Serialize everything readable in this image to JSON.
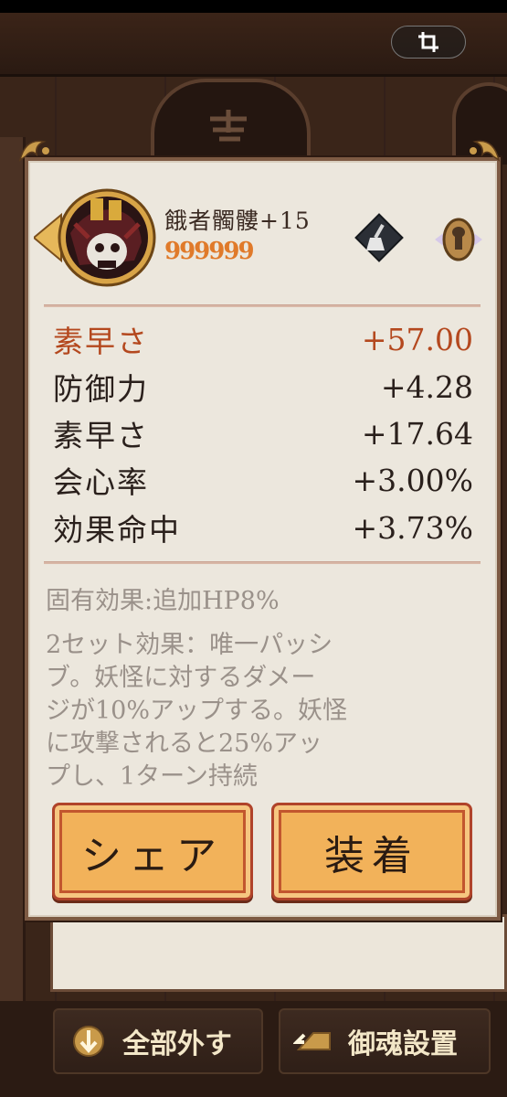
{
  "crop_icon": "crop-icon",
  "item": {
    "name": "餓者髑髏+15",
    "stars": "999999",
    "avatar_icon": "skull-armor-icon",
    "brush_icon": "brush-icon",
    "lock_icon": "lock-icon"
  },
  "stats": {
    "main": {
      "label": "素早さ",
      "value": "+57.00"
    },
    "subs": [
      {
        "label": "防御力",
        "value": "+4.28"
      },
      {
        "label": "素早さ",
        "value": "+17.64"
      },
      {
        "label": "会心率",
        "value": "+3.00%"
      },
      {
        "label": "効果命中",
        "value": "+3.73%"
      }
    ]
  },
  "effects": {
    "inherent": "固有効果:追加HP8%",
    "set_line1": "2セット効果：唯一パッシ",
    "set_line2": "ブ。妖怪に対するダメー",
    "set_line3": "ジが10%アップする。妖怪",
    "set_line4": "に攻撃されると25%アッ",
    "set_line5": "プし、1ターン持続"
  },
  "buttons": {
    "share": "シェア",
    "equip": "装着"
  },
  "bottom_bar": {
    "remove_all": "全部外す",
    "soul_setup": "御魂設置"
  },
  "colors": {
    "main_stat": "#b4481e",
    "stars": "#e07a2a",
    "button": "#f2b25a"
  }
}
